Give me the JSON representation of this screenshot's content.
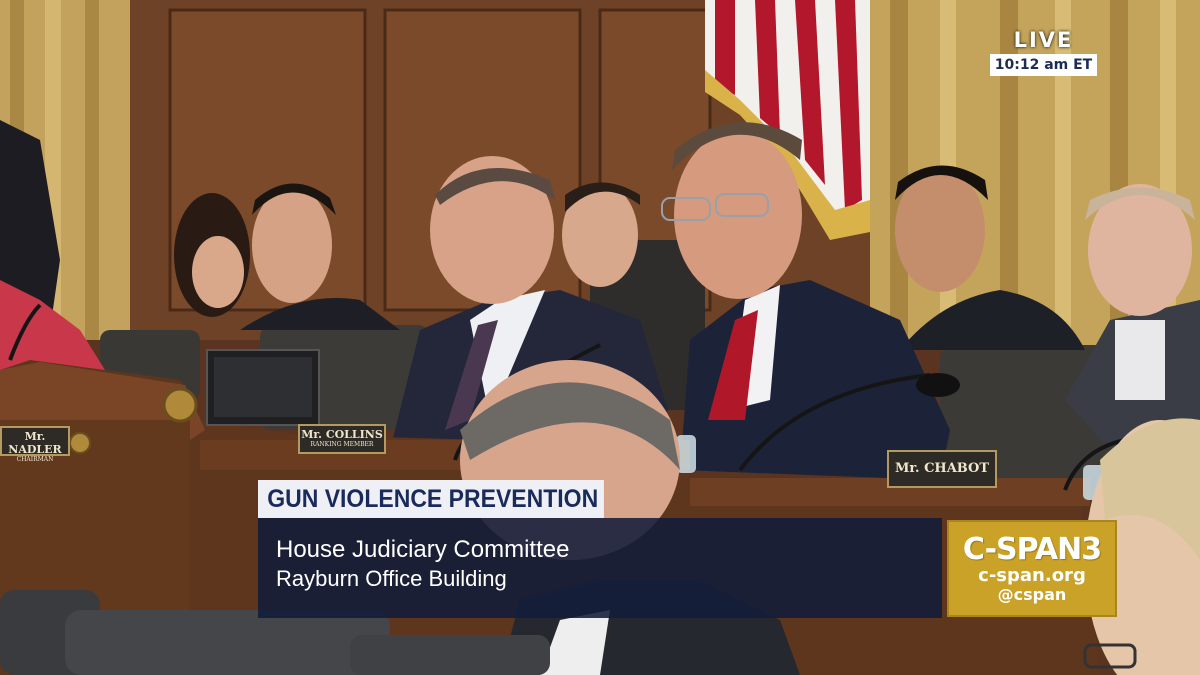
{
  "broadcast": {
    "live_label": "LIVE",
    "time": "10:12 am ET"
  },
  "lower_third": {
    "topic": "GUN VIOLENCE PREVENTION",
    "line1": "House Judiciary Committee",
    "line2": "Rayburn Office Building"
  },
  "logo": {
    "name": "C-SPAN3",
    "url": "c-span.org",
    "handle": "@cspan"
  },
  "nameplates": [
    {
      "name": "Mr. NADLER",
      "title": "CHAIRMAN"
    },
    {
      "name": "Mr. COLLINS",
      "title": "RANKING MEMBER"
    },
    {
      "name": "Mr. CHABOT",
      "title": ""
    }
  ],
  "colors": {
    "topic_text": "#1a2a5a",
    "info_background": "#121c3a",
    "logo_background": "#c9a227",
    "wood_paneling": "#6a3f22",
    "curtain": "#c4a45a"
  }
}
